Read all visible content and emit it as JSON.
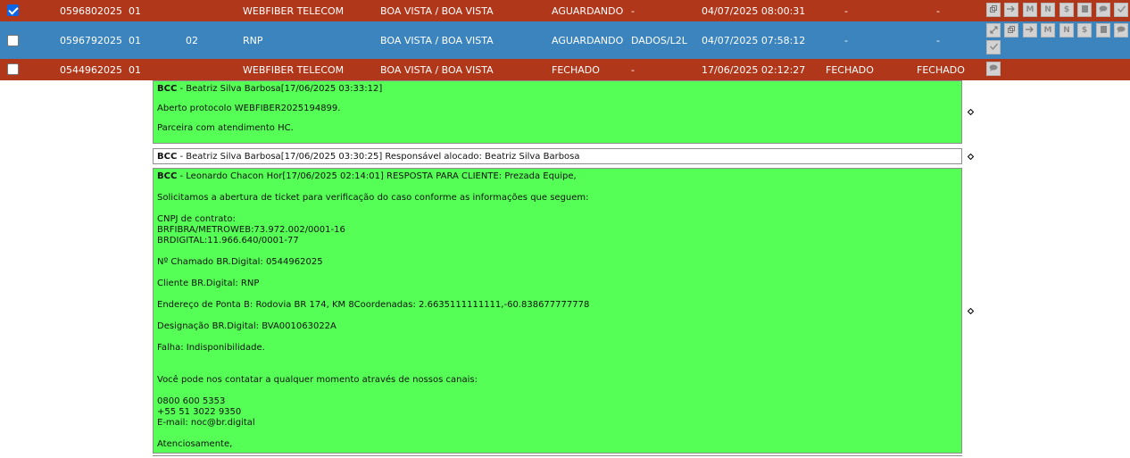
{
  "tickets": [
    {
      "checked": true,
      "number": "0596802025",
      "seq": "01",
      "extra": "",
      "company": "WEBFIBER TELECOM",
      "city": "BOA VISTA / BOA VISTA",
      "status": "AGUARDANDO",
      "service": "-",
      "datetime": "04/07/2025 08:00:31",
      "col_a": "-",
      "col_b": "-"
    },
    {
      "checked": false,
      "number": "0596792025",
      "seq": "01",
      "extra": "02",
      "company": "RNP",
      "city": "BOA VISTA / BOA VISTA",
      "status": "AGUARDANDO",
      "service": "DADOS/L2L",
      "datetime": "04/07/2025 07:58:12",
      "col_a": "-",
      "col_b": "-"
    },
    {
      "checked": false,
      "number": "0544962025",
      "seq": "01",
      "extra": "",
      "company": "WEBFIBER TELECOM",
      "city": "BOA VISTA / BOA VISTA",
      "status": "FECHADO",
      "service": "-",
      "datetime": "17/06/2025 02:12:27",
      "col_a": "FECHADO",
      "col_b": "FECHADO"
    }
  ],
  "action_buttons": {
    "row1": [
      "window-icon",
      "arrow-right-icon",
      "M",
      "N",
      "dollar-icon",
      "stop-icon",
      "comment-icon",
      "check-icon"
    ],
    "row2": [
      "resize-icon",
      "window-icon",
      "arrow-right-icon",
      "M",
      "N",
      "dollar-icon",
      "stop-icon",
      "comment-icon",
      "check-icon"
    ],
    "row3": [
      "comment-icon"
    ],
    "labels": {
      "M": "M",
      "N": "N",
      "dollar": "$"
    }
  },
  "comments": [
    {
      "author_tag": "BCC",
      "header": " - Beatriz Silva Barbosa[17/06/2025 03:33:12]",
      "lines": [
        "Aberto protocolo WEBFIBER2025194899.",
        "Parceira com atendimento HC."
      ]
    },
    {
      "author_tag": "BCC",
      "header": " - Beatriz Silva Barbosa[17/06/2025 03:30:25] Responsável alocado: Beatriz Silva Barbosa",
      "lines": []
    },
    {
      "author_tag": "BCC",
      "header": " - Leonardo Chacon Hor[17/06/2025 02:14:01] RESPOSTA PARA CLIENTE: Prezada Equipe,",
      "lines": [
        "Solicitamos a abertura de ticket para verificação do caso conforme as informações que seguem:",
        "CNPJ de contrato:",
        "BRFIBRA/METROWEB:73.972.002/0001-16",
        "BRDIGITAL:11.966.640/0001-77",
        "Nº Chamado BR.Digital: 0544962025",
        "Cliente BR.Digital: RNP",
        "Endereço de Ponta B: Rodovia BR 174, KM 8Coordenadas: 2.6635111111111,-60.838677777778",
        "Designação BR.Digital: BVA001063022A",
        "Falha: Indisponibilidade.",
        "Você pode nos contatar a qualquer momento através de nossos canais:",
        "0800 600 5353",
        "+55 51 3022 9350",
        "E-mail: noc@br.digital",
        "Atenciosamente,"
      ]
    }
  ],
  "colors": {
    "row_red": "#b1371b",
    "row_blue": "#3b84bd",
    "comment_green": "#55ff55"
  }
}
